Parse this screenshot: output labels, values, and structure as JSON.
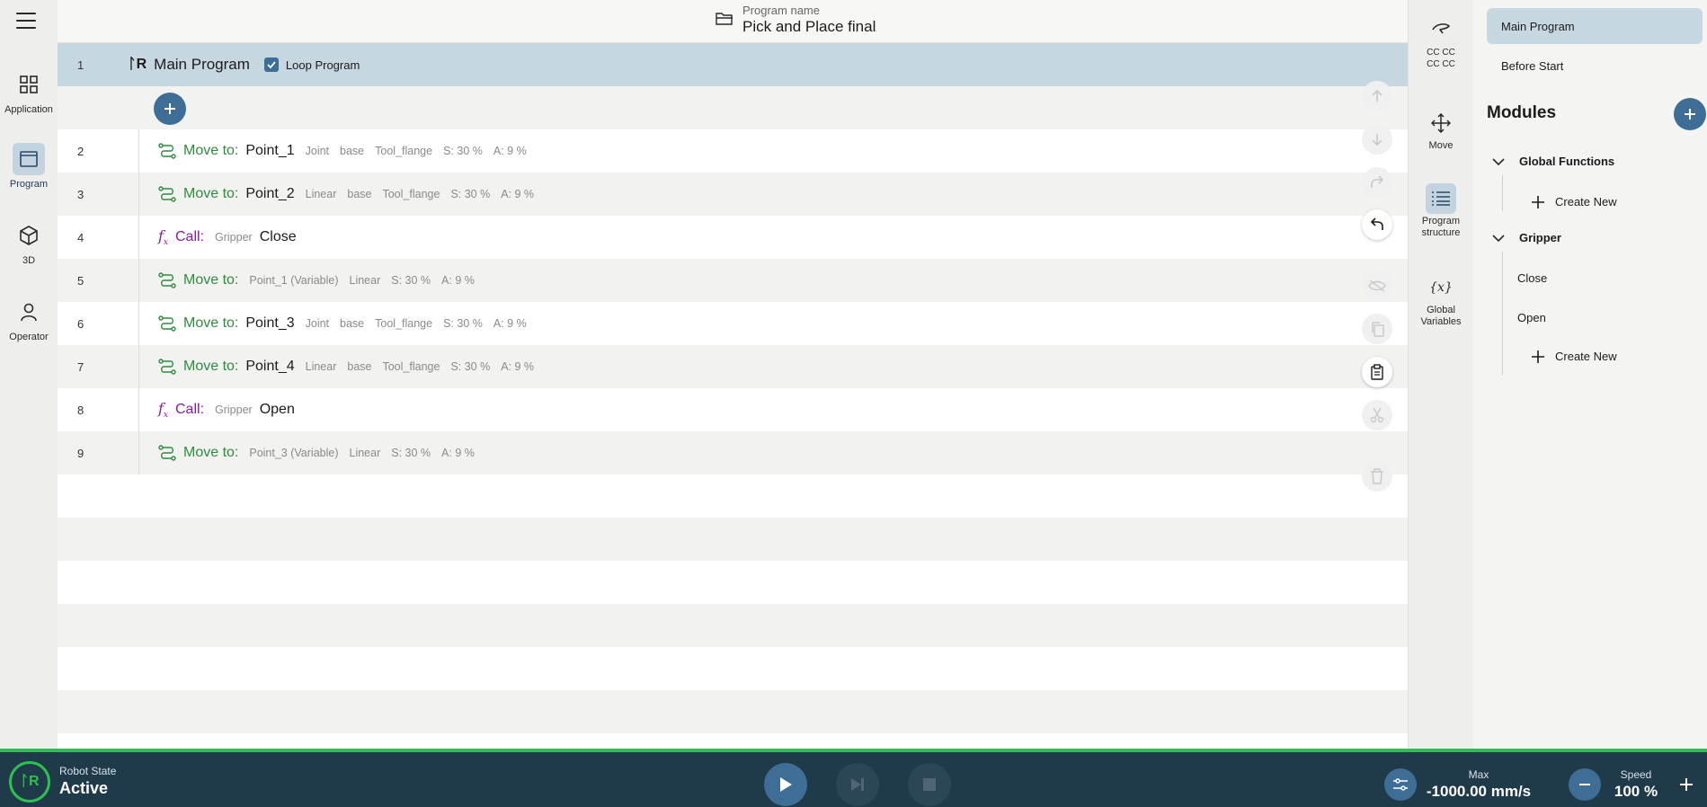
{
  "leftnav": {
    "items": [
      {
        "label": "Application",
        "icon": "grid-icon"
      },
      {
        "label": "Program",
        "icon": "program-icon"
      },
      {
        "label": "3D",
        "icon": "cube-icon"
      },
      {
        "label": "Operator",
        "icon": "person-icon"
      }
    ]
  },
  "header": {
    "program_name_label": "Program name",
    "program_name": "Pick and Place final"
  },
  "tree": {
    "main": {
      "num": "1",
      "title": "Main Program",
      "loop_label": "Loop Program",
      "loop_checked": true
    },
    "rows": [
      {
        "num": "2",
        "kw": "Move to:",
        "target": "Point_1",
        "meta": [
          "Joint",
          "base",
          "Tool_flange",
          "S: 30 %",
          "A: 9 %"
        ]
      },
      {
        "num": "3",
        "kw": "Move to:",
        "target": "Point_2",
        "meta": [
          "Linear",
          "base",
          "Tool_flange",
          "S: 30 %",
          "A: 9 %"
        ]
      },
      {
        "num": "4",
        "kw": "Call:",
        "target": "Close",
        "pre": "Gripper"
      },
      {
        "num": "5",
        "kw": "Move to:",
        "target": "",
        "meta": [
          "Point_1 (Variable)",
          "Linear",
          "S: 30 %",
          "A: 9 %"
        ]
      },
      {
        "num": "6",
        "kw": "Move to:",
        "target": "Point_3",
        "meta": [
          "Joint",
          "base",
          "Tool_flange",
          "S: 30 %",
          "A: 9 %"
        ]
      },
      {
        "num": "7",
        "kw": "Move to:",
        "target": "Point_4",
        "meta": [
          "Linear",
          "base",
          "Tool_flange",
          "S: 30 %",
          "A: 9 %"
        ]
      },
      {
        "num": "8",
        "kw": "Call:",
        "target": "Open",
        "pre": "Gripper"
      },
      {
        "num": "9",
        "kw": "Move to:",
        "target": "",
        "meta": [
          "Point_3 (Variable)",
          "Linear",
          "S: 30 %",
          "A: 9 %"
        ]
      }
    ]
  },
  "rail": {
    "items": [
      {
        "label": "CC CC\nCC CC",
        "icon": "hand-icon"
      },
      {
        "label": "Move",
        "icon": "move-arrows-icon"
      },
      {
        "label": "Program structure",
        "icon": "list-icon"
      },
      {
        "label": "Global Variables",
        "icon": "variable-icon"
      }
    ]
  },
  "rpanel": {
    "tabs": [
      "Main Program",
      "Before Start"
    ],
    "modules_title": "Modules",
    "groups": [
      {
        "name": "Global Functions",
        "items": [],
        "create": "Create New"
      },
      {
        "name": "Gripper",
        "items": [
          "Close",
          "Open"
        ],
        "create": "Create New"
      }
    ]
  },
  "bottombar": {
    "state_label": "Robot State",
    "state_value": "Active",
    "max_label": "Max",
    "max_value": "-1000.00 mm/s",
    "speed_label": "Speed",
    "speed_value": "100 %"
  },
  "colors": {
    "accent": "#3e6e96",
    "move_green": "#2e8b3d",
    "call_purple": "#8a1a9e",
    "status_green": "#2fbf4f",
    "bottombar": "#1f3a49"
  }
}
